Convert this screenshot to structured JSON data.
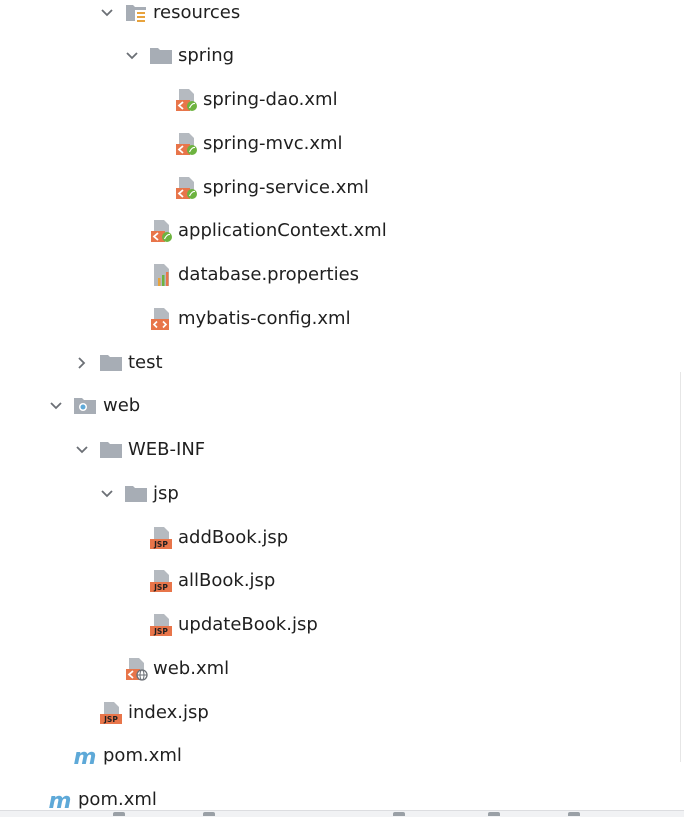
{
  "tree": {
    "items": [
      {
        "label": "resources",
        "icon": "resources-folder-icon",
        "expanded": true
      },
      {
        "label": "spring",
        "icon": "folder-icon",
        "expanded": true
      },
      {
        "label": "spring-dao.xml",
        "icon": "spring-xml-icon"
      },
      {
        "label": "spring-mvc.xml",
        "icon": "spring-xml-icon"
      },
      {
        "label": "spring-service.xml",
        "icon": "spring-xml-icon"
      },
      {
        "label": "applicationContext.xml",
        "icon": "spring-xml-icon"
      },
      {
        "label": "database.properties",
        "icon": "properties-file-icon"
      },
      {
        "label": "mybatis-config.xml",
        "icon": "xml-file-icon"
      },
      {
        "label": "test",
        "icon": "folder-icon",
        "expanded": false
      },
      {
        "label": "web",
        "icon": "web-folder-icon",
        "expanded": true
      },
      {
        "label": "WEB-INF",
        "icon": "folder-icon",
        "expanded": true
      },
      {
        "label": "jsp",
        "icon": "folder-icon",
        "expanded": true
      },
      {
        "label": "addBook.jsp",
        "icon": "jsp-file-icon"
      },
      {
        "label": "allBook.jsp",
        "icon": "jsp-file-icon"
      },
      {
        "label": "updateBook.jsp",
        "icon": "jsp-file-icon"
      },
      {
        "label": "web.xml",
        "icon": "web-xml-icon"
      },
      {
        "label": "index.jsp",
        "icon": "jsp-file-icon"
      },
      {
        "label": "pom.xml",
        "icon": "maven-icon"
      },
      {
        "label": "pom.xml",
        "icon": "maven-icon"
      }
    ]
  },
  "colors": {
    "folder": "#a7adb5",
    "chevron": "#6b6f75",
    "xml_orange": "#e8754a",
    "spring_green": "#6db33f",
    "maven_blue": "#5ea9d8",
    "properties_bars": "#e8a33d"
  }
}
